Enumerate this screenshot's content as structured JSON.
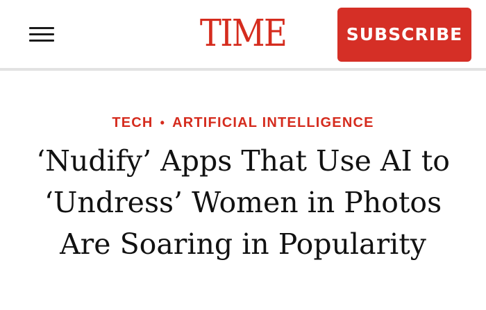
{
  "header": {
    "logo_text": "TIME",
    "subscribe_label": "SUBSCRIBE",
    "menu_icon": "hamburger-menu-icon"
  },
  "article": {
    "categories": [
      {
        "label": "TECH"
      },
      {
        "label": "ARTIFICIAL INTELLIGENCE"
      }
    ],
    "separator": "•",
    "headline_lines": [
      "‘Nudify’ Apps That Use AI to",
      "‘Undress’ Women in Photos",
      "Are Soaring in Popularity"
    ]
  },
  "colors": {
    "brand_red": "#d52c1e",
    "subscribe_bg": "#d52f26",
    "text_dark": "#111111",
    "divider": "#e2e2e2"
  }
}
